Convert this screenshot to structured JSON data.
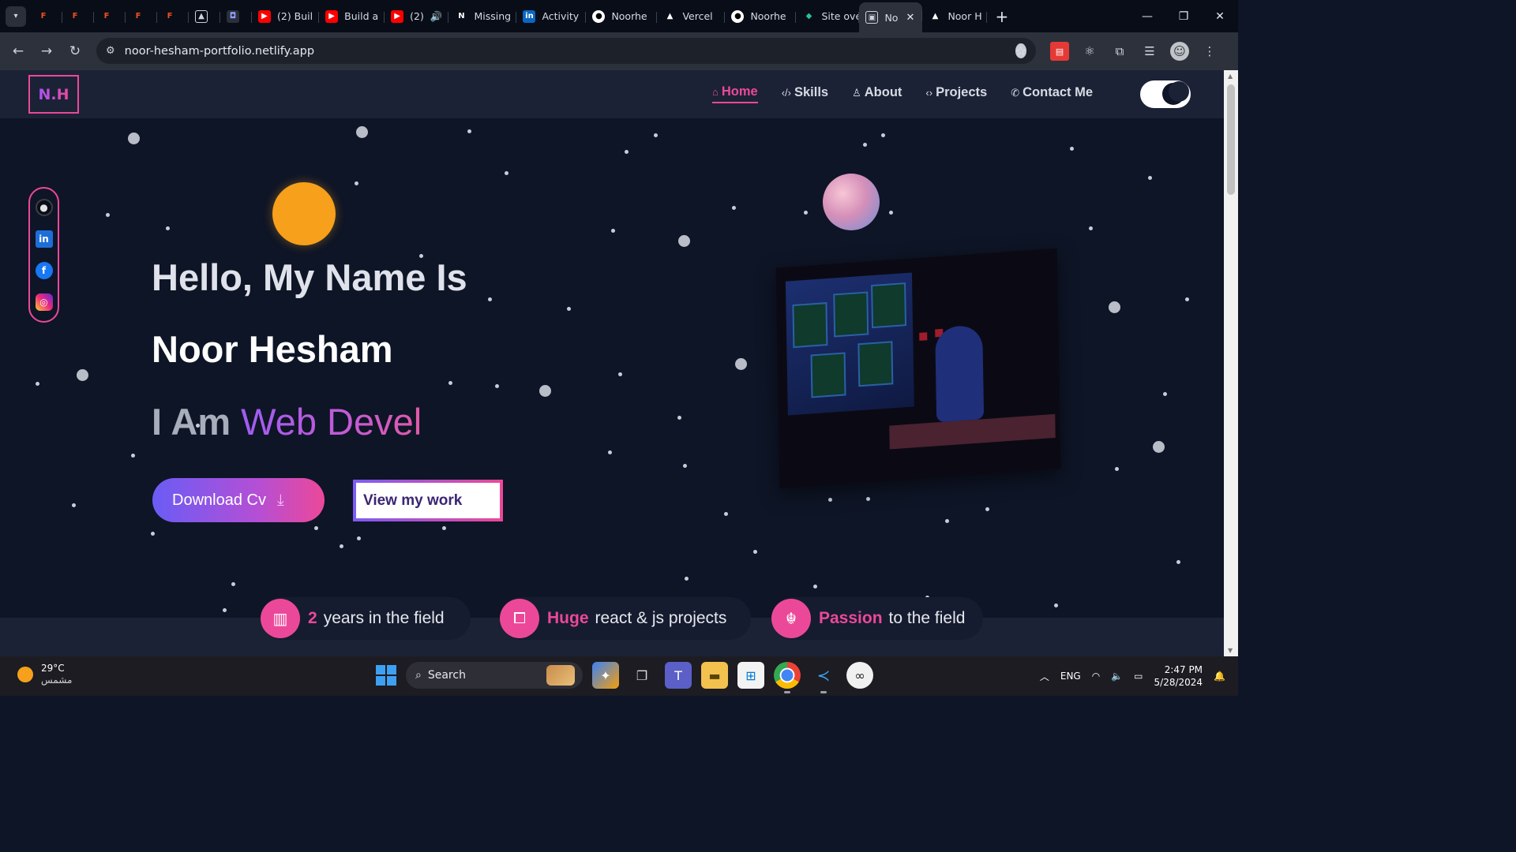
{
  "browser": {
    "tabs": [
      {
        "label": "",
        "icon": "figma-icon",
        "color": "#f24e1e"
      },
      {
        "label": "",
        "icon": "figma-icon",
        "color": "#f24e1e"
      },
      {
        "label": "",
        "icon": "figma-icon",
        "color": "#f24e1e"
      },
      {
        "label": "",
        "icon": "figma-icon",
        "color": "#f24e1e"
      },
      {
        "label": "",
        "icon": "figma-icon",
        "color": "#f24e1e"
      },
      {
        "label": "",
        "icon": "image-icon",
        "color": "#cfd3da"
      },
      {
        "label": "",
        "icon": "app-icon",
        "color": "#5865f2"
      },
      {
        "label": "(2) Buil",
        "icon": "youtube-icon",
        "color": "#ff0000"
      },
      {
        "label": "Build a",
        "icon": "youtube-icon",
        "color": "#ff0000"
      },
      {
        "label": "(2)",
        "icon": "youtube-icon",
        "color": "#ff0000"
      },
      {
        "label": "Missing",
        "icon": "notion-icon",
        "color": "#ffffff"
      },
      {
        "label": "Activity",
        "icon": "linkedin-icon",
        "color": "#0a66c2"
      },
      {
        "label": "Noorhe",
        "icon": "github-icon",
        "color": "#ffffff"
      },
      {
        "label": "Vercel",
        "icon": "vercel-icon",
        "color": "#ffffff"
      },
      {
        "label": "Noorhe",
        "icon": "github-icon",
        "color": "#ffffff"
      },
      {
        "label": "Site ove",
        "icon": "netlify-icon",
        "color": "#25c2a0"
      },
      {
        "label": "No",
        "icon": "page-icon",
        "color": "#cfd3da",
        "active": true
      },
      {
        "label": "Noor H",
        "icon": "vercel-icon",
        "color": "#ffffff"
      }
    ],
    "url": "noor-hesham-portfolio.netlify.app"
  },
  "header": {
    "logo": "N.H",
    "nav": [
      {
        "label": "Home",
        "icon": "home-icon",
        "active": true
      },
      {
        "label": "Skills",
        "icon": "code-icon"
      },
      {
        "label": "About",
        "icon": "user-icon"
      },
      {
        "label": "Projects",
        "icon": "brackets-icon"
      },
      {
        "label": "Contact Me",
        "icon": "phone-icon"
      }
    ]
  },
  "hero": {
    "greeting": "Hello, My Name Is",
    "name": "Noor Hesham",
    "role_prefix": "I Am",
    "role_typed": "Web Devel",
    "download_button": "Download Cv",
    "work_button": "View my work"
  },
  "stats": [
    {
      "highlight": "2",
      "text": "years in the field",
      "icon": "chart-icon"
    },
    {
      "highlight": "Huge",
      "text": "react & js projects",
      "icon": "code-window-icon"
    },
    {
      "highlight": "Passion",
      "text": "to the field",
      "icon": "passion-icon"
    }
  ],
  "taskbar": {
    "temperature": "29°C",
    "weather": "مشمس",
    "search_label": "Search",
    "language": "ENG",
    "time": "2:47 PM",
    "date": "5/28/2024"
  },
  "colors": {
    "accent": "#ec4899",
    "purple": "#a855f7",
    "background": "#0e1526",
    "header": "#1b2236"
  }
}
